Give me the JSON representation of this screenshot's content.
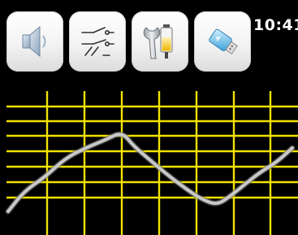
{
  "status_bar": {
    "time": "10:41"
  },
  "toolbar": {
    "buttons": [
      {
        "icon": "speaker-icon",
        "function": "audio"
      },
      {
        "icon": "switch-diagram-icon",
        "function": "circuit"
      },
      {
        "icon": "wrench-battery-icon",
        "function": "settings"
      },
      {
        "icon": "usb-drive-icon",
        "function": "usb"
      }
    ]
  },
  "waveform_display": {
    "grid_color": "#f2e200",
    "trace_color": "#c8c8c8",
    "background": "#000000",
    "grid": "on"
  }
}
